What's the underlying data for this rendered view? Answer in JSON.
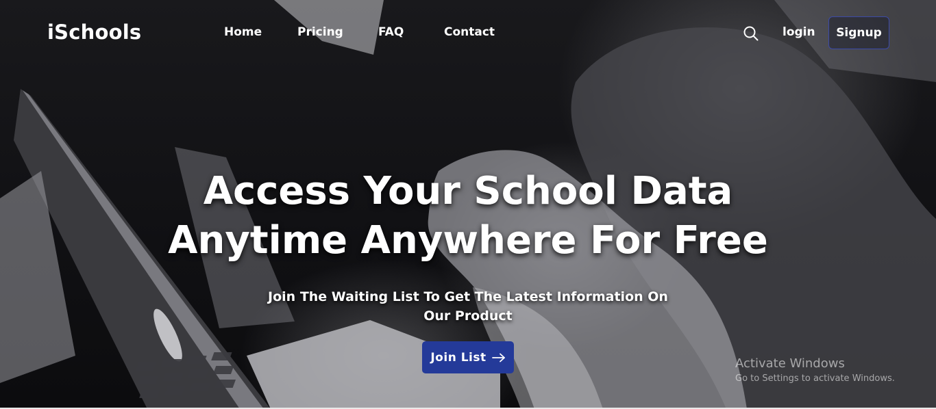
{
  "nav": {
    "brand": "iSchools",
    "links": [
      {
        "label": "Home"
      },
      {
        "label": "Pricing"
      },
      {
        "label": "FAQ"
      },
      {
        "label": "Contact"
      }
    ],
    "search_icon": "search-icon",
    "login_label": "login",
    "signup_label": "Signup"
  },
  "hero": {
    "headline_line1": "Access Your School Data",
    "headline_line2": "Anytime Anywhere For Free",
    "subline_line1": "Join The Waiting List To Get The Latest Information On",
    "subline_line2": "Our Product",
    "cta_label": "Join List",
    "cta_icon": "arrow-right-icon"
  },
  "watermark": {
    "title": "Activate Windows",
    "subtitle": "Go to Settings to activate Windows."
  },
  "colors": {
    "accent": "#243a99",
    "signup_border": "#3c4aa8",
    "text": "#ffffff"
  }
}
